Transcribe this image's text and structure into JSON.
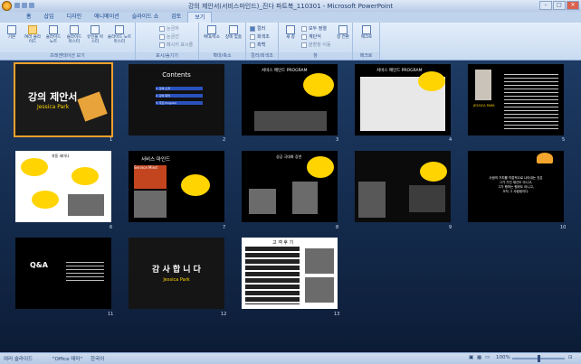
{
  "window": {
    "title": "강의 제안서(서비스마인드)_진다 파트북_110301 - Microsoft PowerPoint"
  },
  "tabs": [
    "홈",
    "삽입",
    "디자인",
    "애니메이션",
    "슬라이드 쇼",
    "검토",
    "보기"
  ],
  "ribbon": {
    "views": [
      "기본",
      "여러 슬라이드",
      "슬라이드 노트",
      "슬라이드 마스터",
      "유인물 마스터",
      "슬라이드 노트 마스터"
    ],
    "views_group": "프레젠테이션 보기",
    "show": [
      "눈금자",
      "눈금선",
      "메시지 표시줄"
    ],
    "show_group": "표시/숨기기",
    "zoom": [
      "확대/축소",
      "창에 맞춤"
    ],
    "zoom_group": "확대/축소",
    "color": [
      "컬러",
      "회색조",
      "흑백"
    ],
    "color_group": "컬러/회색조",
    "window": [
      "새 창",
      "모두 정렬",
      "계단식",
      "분할창 이동",
      "창 전환"
    ],
    "window_group": "창",
    "macro": "매크로",
    "macro_group": "매크로"
  },
  "slides": [
    {
      "num": "1",
      "title": "강의 제안서",
      "subtitle": "Jessica Park"
    },
    {
      "num": "2",
      "title": "Contents",
      "items": [
        "1. 강의 소개",
        "2. 강의 목적",
        "3. 주요 Program"
      ]
    },
    {
      "num": "3",
      "title": "서비스 매인드 PROGRAM"
    },
    {
      "num": "4",
      "title": "서비스 매인드 PROGRAM"
    },
    {
      "num": "5",
      "title": "JESSICA PARK"
    },
    {
      "num": "6",
      "title": "자동 세미나"
    },
    {
      "num": "7",
      "title": "서비스 마인드",
      "subtitle": "Service Mind"
    },
    {
      "num": "8",
      "title": "성공 극대화 강연"
    },
    {
      "num": "9",
      "title": ""
    },
    {
      "num": "10",
      "lines": [
        "사람의 가치를 직접적으로 나타내는 것은",
        "그가 가진 재산도 아니고,",
        "그가 행하는 행위도 아니고,",
        "오직 그 사람됨이다."
      ]
    },
    {
      "num": "11",
      "title": "Q&A"
    },
    {
      "num": "12",
      "title": "감 사 합 니 다",
      "subtitle": "Jessica Park"
    },
    {
      "num": "13",
      "title": "고 객 후 기"
    }
  ],
  "status": {
    "view": "여러 슬라이드",
    "theme": "\"Office 테마\"",
    "lang": "한국어",
    "zoom": "100%"
  }
}
